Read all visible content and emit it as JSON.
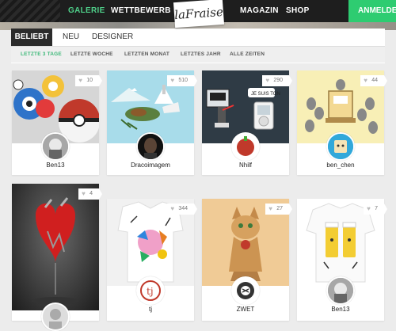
{
  "nav": {
    "items": [
      "GALERIE",
      "WETTBEWERB",
      "MAGAZIN",
      "SHOP"
    ],
    "logo": "laFraise",
    "login": "ANMELDEN"
  },
  "filter": {
    "tabs": [
      "BELIEBT",
      "NEU",
      "DESIGNER"
    ],
    "periods": [
      "LETZTE 3 TAGE",
      "LETZTE WOCHE",
      "LETZTEN MONAT",
      "LETZTES JAHR",
      "ALLE ZEITEN"
    ]
  },
  "cards": [
    {
      "user": "Ben13",
      "likes": "10"
    },
    {
      "user": "Dracoimagem",
      "likes": "510"
    },
    {
      "user": "Nhilf",
      "likes": "290"
    },
    {
      "user": "ben_chen",
      "likes": "44"
    },
    {
      "user": "",
      "likes": "4"
    },
    {
      "user": "tj",
      "likes": "344"
    },
    {
      "user": "ZWET",
      "likes": "27"
    },
    {
      "user": "Ben13",
      "likes": "7"
    }
  ],
  "colors": {
    "accent": "#2ecc71",
    "topbar": "#1e1e1e"
  }
}
